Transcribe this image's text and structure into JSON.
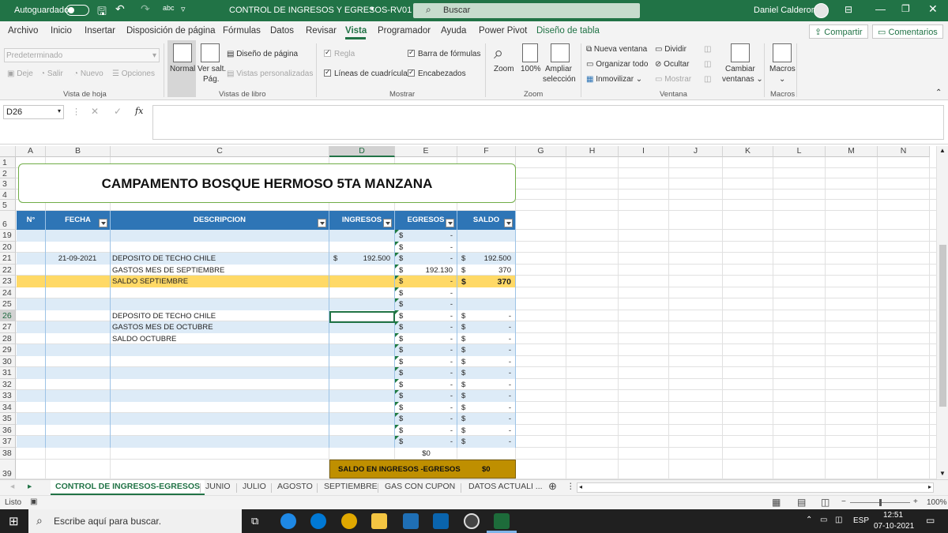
{
  "titlebar": {
    "autosave_label": "Autoguardado",
    "doc_title": "CONTROL DE INGRESOS Y EGRESOS-RV01",
    "search_placeholder": "Buscar",
    "user_name": "Daniel Calderon",
    "accent": "#217346"
  },
  "menu": {
    "items": [
      "Archivo",
      "Inicio",
      "Insertar",
      "Disposición de página",
      "Fórmulas",
      "Datos",
      "Revisar",
      "Vista",
      "Programador",
      "Ayuda",
      "Power Pivot",
      "Diseño de tabla"
    ],
    "active": "Vista",
    "share_label": "Compartir",
    "comments_label": "Comentarios"
  },
  "ribbon": {
    "sheet_view": {
      "dropdown_value": "Predeterminado",
      "keep": "Deje",
      "exit": "Salir",
      "new": "Nuevo",
      "options": "Opciones",
      "group": "Vista de hoja"
    },
    "workbook_views": {
      "normal": "Normal",
      "page_break_1": "Ver salt.",
      "page_break_2": "Pág.",
      "page_layout": "Diseño de página",
      "custom_views": "Vistas personalizadas",
      "group": "Vistas de libro"
    },
    "show": {
      "ruler": "Regla",
      "formula_bar": "Barra de fórmulas",
      "gridlines": "Líneas de cuadrícula",
      "headings": "Encabezados",
      "group": "Mostrar"
    },
    "zoom": {
      "zoom": "Zoom",
      "hundred": "100%",
      "zoom_sel_1": "Ampliar",
      "zoom_sel_2": "selección",
      "group": "Zoom"
    },
    "window": {
      "new_window": "Nueva ventana",
      "arrange_all": "Organizar todo",
      "freeze": "Inmovilizar",
      "split": "Dividir",
      "hide": "Ocultar",
      "unhide": "Mostrar",
      "switch_1": "Cambiar",
      "switch_2": "ventanas",
      "group": "Ventana"
    },
    "macros": {
      "label": "Macros",
      "group": "Macros"
    }
  },
  "formula_bar": {
    "name_box": "D26",
    "fx": "fx",
    "content": ""
  },
  "columns": [
    "A",
    "B",
    "C",
    "D",
    "E",
    "F",
    "G",
    "H",
    "I",
    "J",
    "K",
    "L",
    "M",
    "N"
  ],
  "selected_column": "D",
  "rows": [
    "1",
    "2",
    "3",
    "4",
    "5",
    "6",
    "19",
    "20",
    "21",
    "22",
    "23",
    "24",
    "25",
    "26",
    "27",
    "28",
    "29",
    "30",
    "31",
    "32",
    "33",
    "34",
    "35",
    "36",
    "37",
    "38",
    "39"
  ],
  "selected_row": "26",
  "sheet": {
    "title": "CAMPAMENTO BOSQUE HERMOSO 5TA MANZANA",
    "headers": {
      "no": "N°",
      "fecha": "FECHA",
      "descripcion": "DESCRIPCION",
      "ingresos": "INGRESOS",
      "egresos": "EGRESOS",
      "saldo": "SALDO"
    },
    "table_rows": [
      {
        "row": "19",
        "fecha": "",
        "desc": "",
        "ing_cur": "",
        "ing": "",
        "eg_cur": "$",
        "eg": "-",
        "sal_cur": "",
        "sal": ""
      },
      {
        "row": "20",
        "fecha": "",
        "desc": "",
        "ing_cur": "",
        "ing": "",
        "eg_cur": "$",
        "eg": "-",
        "sal_cur": "",
        "sal": ""
      },
      {
        "row": "21",
        "fecha": "21-09-2021",
        "desc": "DEPOSITO DE TECHO CHILE",
        "ing_cur": "$",
        "ing": "192.500",
        "eg_cur": "$",
        "eg": "-",
        "sal_cur": "$",
        "sal": "192.500"
      },
      {
        "row": "22",
        "fecha": "",
        "desc": "GASTOS MES DE SEPTIEMBRE",
        "ing_cur": "",
        "ing": "",
        "eg_cur": "$",
        "eg": "192.130",
        "sal_cur": "$",
        "sal": "370"
      },
      {
        "row": "23",
        "fecha": "",
        "desc": "SALDO SEPTIEMBRE",
        "ing_cur": "",
        "ing": "",
        "eg_cur": "$",
        "eg": "-",
        "sal_cur": "$",
        "sal": "370"
      },
      {
        "row": "24",
        "fecha": "",
        "desc": "",
        "ing_cur": "",
        "ing": "",
        "eg_cur": "$",
        "eg": "-",
        "sal_cur": "",
        "sal": ""
      },
      {
        "row": "25",
        "fecha": "",
        "desc": "",
        "ing_cur": "",
        "ing": "",
        "eg_cur": "$",
        "eg": "-",
        "sal_cur": "",
        "sal": ""
      },
      {
        "row": "26",
        "fecha": "",
        "desc": "DEPOSITO DE TECHO CHILE",
        "ing_cur": "",
        "ing": "",
        "eg_cur": "$",
        "eg": "-",
        "sal_cur": "$",
        "sal": "-"
      },
      {
        "row": "27",
        "fecha": "",
        "desc": "GASTOS MES DE OCTUBRE",
        "ing_cur": "",
        "ing": "",
        "eg_cur": "$",
        "eg": "-",
        "sal_cur": "$",
        "sal": "-"
      },
      {
        "row": "28",
        "fecha": "",
        "desc": "SALDO OCTUBRE",
        "ing_cur": "",
        "ing": "",
        "eg_cur": "$",
        "eg": "-",
        "sal_cur": "$",
        "sal": "-"
      },
      {
        "row": "29",
        "fecha": "",
        "desc": "",
        "ing_cur": "",
        "ing": "",
        "eg_cur": "$",
        "eg": "-",
        "sal_cur": "$",
        "sal": "-"
      },
      {
        "row": "30",
        "fecha": "",
        "desc": "",
        "ing_cur": "",
        "ing": "",
        "eg_cur": "$",
        "eg": "-",
        "sal_cur": "$",
        "sal": "-"
      },
      {
        "row": "31",
        "fecha": "",
        "desc": "",
        "ing_cur": "",
        "ing": "",
        "eg_cur": "$",
        "eg": "-",
        "sal_cur": "$",
        "sal": "-"
      },
      {
        "row": "32",
        "fecha": "",
        "desc": "",
        "ing_cur": "",
        "ing": "",
        "eg_cur": "$",
        "eg": "-",
        "sal_cur": "$",
        "sal": "-"
      },
      {
        "row": "33",
        "fecha": "",
        "desc": "",
        "ing_cur": "",
        "ing": "",
        "eg_cur": "$",
        "eg": "-",
        "sal_cur": "$",
        "sal": "-"
      },
      {
        "row": "34",
        "fecha": "",
        "desc": "",
        "ing_cur": "",
        "ing": "",
        "eg_cur": "$",
        "eg": "-",
        "sal_cur": "$",
        "sal": "-"
      },
      {
        "row": "35",
        "fecha": "",
        "desc": "",
        "ing_cur": "",
        "ing": "",
        "eg_cur": "$",
        "eg": "-",
        "sal_cur": "$",
        "sal": "-"
      },
      {
        "row": "36",
        "fecha": "",
        "desc": "",
        "ing_cur": "",
        "ing": "",
        "eg_cur": "$",
        "eg": "-",
        "sal_cur": "$",
        "sal": "-"
      },
      {
        "row": "37",
        "fecha": "",
        "desc": "",
        "ing_cur": "",
        "ing": "",
        "eg_cur": "$",
        "eg": "-",
        "sal_cur": "$",
        "sal": "-"
      }
    ],
    "total_egresos": "$0",
    "saldo_label": "SALDO EN INGRESOS -EGRESOS",
    "saldo_value": "$0",
    "header_color": "#2e75b6",
    "band_color": "#ddebf7",
    "highlight_color": "#ffd966",
    "saldo_box_color": "#bf8f00"
  },
  "tabs": {
    "items": [
      "CONTROL DE INGRESOS-EGRESOS",
      "JUNIO",
      "JULIO",
      "AGOSTO",
      "SEPTIEMBRE",
      "GAS CON CUPON",
      "DATOS ACTUALI ..."
    ],
    "active": "CONTROL DE INGRESOS-EGRESOS"
  },
  "status": {
    "ready": "Listo",
    "zoom": "100%"
  },
  "taskbar": {
    "search_placeholder": "Escribe aquí para buscar.",
    "lang": "ESP",
    "time": "12:51",
    "date": "07-10-2021"
  }
}
